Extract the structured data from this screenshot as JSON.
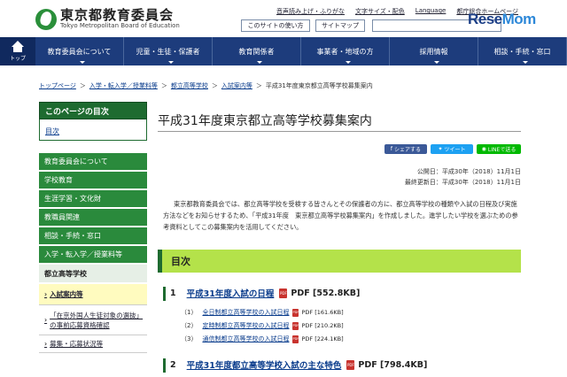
{
  "header": {
    "logo_jp": "東京都教育委員会",
    "logo_en": "Tokyo Metropolitan Board of Education",
    "links": [
      "音声読み上げ・ふりがな",
      "文字サイズ・配色",
      "Language",
      "都庁総合ホームページ"
    ],
    "site_help": "このサイトの使い方",
    "sitemap": "サイトマップ",
    "search_placeholder": "",
    "brand_pre": "Rese",
    "brand_post": "Mom"
  },
  "nav": {
    "home": "トップ",
    "items": [
      "教育委員会について",
      "児童・生徒・保護者",
      "教育関係者",
      "事業者・地域の方",
      "採用情報",
      "相談・手続・窓口"
    ]
  },
  "breadcrumb": [
    "トップページ",
    "入学・転入学／授業料等",
    "都立高等学校",
    "入試案内等",
    "平成31年度東京都立高等学校募集案内"
  ],
  "sidebar": {
    "head": "このページの目次",
    "toc": "目次",
    "items": [
      "教育委員会について",
      "学校教育",
      "生涯学習・文化財",
      "教職員関連",
      "相談・手続・窓口",
      "入学・転入学／授業料等"
    ],
    "current": "都立高等学校",
    "subs": [
      "入試案内等",
      "「在京外国人生徒対象の選抜」の事前応募資格確認",
      "募集・応募状況等"
    ]
  },
  "main": {
    "title": "平成31年度東京都立高等学校募集案内",
    "share": [
      "シェアする",
      "ツイート",
      "LINEで送る"
    ],
    "published": "公開日：平成30年（2018）11月1日",
    "updated": "最終更新日：平成30年（2018）11月1日",
    "intro": "東京都教育委員会では、都立高等学校を受検する皆さんとその保護者の方に、都立高等学校の種類や入試の日程及び実施方法などをお知らせするため、「平成31年度　東京都立高等学校募集案内」を作成しました。進学したい学校を選ぶための参考資料としてこの募集案内を活用してください。",
    "toc_heading": "目次",
    "sections": [
      {
        "num": "1",
        "title": "平成31年度入試の日程",
        "pdf": "PDF [552.8KB]",
        "subs": [
          {
            "num": "（1）",
            "label": "全日制都立高等学校の入試日程",
            "pdf": "PDF [161.6KB]"
          },
          {
            "num": "（2）",
            "label": "定時制都立高等学校の入試日程",
            "pdf": "PDF [210.2KB]"
          },
          {
            "num": "（3）",
            "label": "通信制都立高等学校の入試日程",
            "pdf": "PDF [224.1KB]"
          }
        ]
      },
      {
        "num": "2",
        "title": "平成31年度都立高等学校入試の主な特色",
        "pdf": "PDF [798.4KB]",
        "subs": []
      }
    ]
  },
  "colors": {
    "nav": "#1d3c7c",
    "sidebar": "#2a8a3c",
    "toc_bar": "#b4e24a",
    "facebook": "#3b5998",
    "twitter": "#1da1f2",
    "line": "#00b900"
  }
}
